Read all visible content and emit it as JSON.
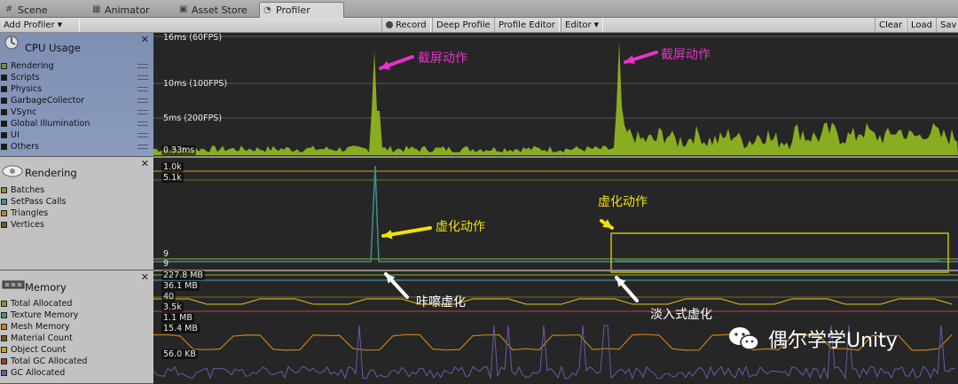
{
  "tabs": [
    {
      "label": "Scene",
      "icon": "scene-icon"
    },
    {
      "label": "Animator",
      "icon": "animator-icon"
    },
    {
      "label": "Asset Store",
      "icon": "store-icon"
    },
    {
      "label": "Profiler",
      "icon": "profiler-icon"
    }
  ],
  "toolbar": {
    "add_profiler": "Add Profiler",
    "record": "Record",
    "deep_profile": "Deep Profile",
    "profile_editor": "Profile Editor",
    "editor": "Editor",
    "clear": "Clear",
    "load": "Load",
    "save": "Sav"
  },
  "sections": {
    "cpu": {
      "title": "CPU Usage",
      "items": [
        {
          "label": "Rendering",
          "color": "#6f9a1c"
        },
        {
          "label": "Scripts",
          "color": "#1a1a1a"
        },
        {
          "label": "Physics",
          "color": "#1a1a1a"
        },
        {
          "label": "GarbageCollector",
          "color": "#1a1a1a"
        },
        {
          "label": "VSync",
          "color": "#1a1a1a"
        },
        {
          "label": "Global Illumination",
          "color": "#1a1a1a"
        },
        {
          "label": "UI",
          "color": "#1a1a1a"
        },
        {
          "label": "Others",
          "color": "#1a1a1a"
        }
      ]
    },
    "rendering": {
      "title": "Rendering",
      "items": [
        {
          "label": "Batches",
          "color": "#7e9a2a"
        },
        {
          "label": "SetPass Calls",
          "color": "#3f8f8f"
        },
        {
          "label": "Triangles",
          "color": "#c87d1d"
        },
        {
          "label": "Vertices",
          "color": "#6e5a22"
        }
      ]
    },
    "memory": {
      "title": "Memory",
      "items": [
        {
          "label": "Total Allocated",
          "color": "#7e9a2a"
        },
        {
          "label": "Texture Memory",
          "color": "#3f8f8f"
        },
        {
          "label": "Mesh Memory",
          "color": "#c87d1d"
        },
        {
          "label": "Material Count",
          "color": "#6e5a22"
        },
        {
          "label": "Object Count",
          "color": "#c8a21d"
        },
        {
          "label": "Total GC Allocated",
          "color": "#a33a3a"
        },
        {
          "label": "GC Allocated",
          "color": "#6a5aa8"
        }
      ]
    }
  },
  "graphs": {
    "cpu_labels": [
      "16ms (60FPS)",
      "10ms (100FPS)",
      "5ms (200FPS)",
      "0.33ms"
    ],
    "rendering_labels": [
      "1.0k",
      "5.1k",
      "9",
      "9"
    ],
    "memory_labels": [
      "227.8 MB",
      "36.1 MB",
      "40",
      "3.5k",
      "1.1 MB",
      "15.4 MB",
      "56.0 KB"
    ]
  },
  "annotations": {
    "screenshot_1": "截屏动作",
    "screenshot_2": "截屏动作",
    "blur_action": "虚化动作",
    "blur_action_2": "虚化动作",
    "instant_blur": "咔嚓虚化",
    "fade_blur": "淡入式虚化"
  },
  "watermark": "偶尔学学Unity",
  "colors": {
    "cpu_bar": "#8fb320",
    "magenta": "#e633c8",
    "yellow": "#f0e010",
    "white": "#ffffff"
  }
}
